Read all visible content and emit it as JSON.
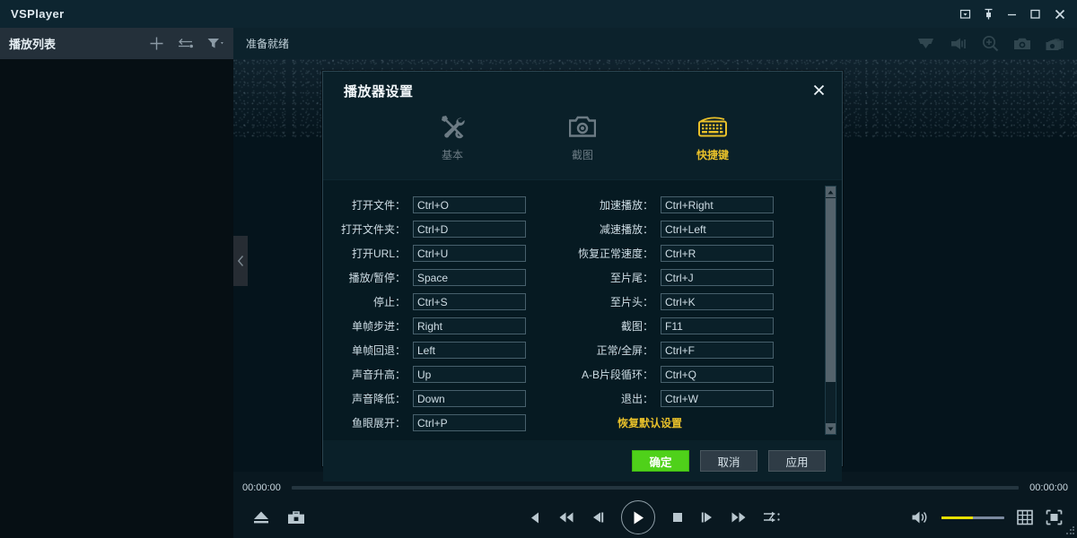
{
  "titlebar": {
    "app_title": "VSPlayer",
    "buttons": [
      {
        "name": "restore-down",
        "icon": "window-restore-icon"
      },
      {
        "name": "pin",
        "icon": "pin-icon"
      },
      {
        "name": "minimize",
        "icon": "minimize-icon"
      },
      {
        "name": "maximize",
        "icon": "maximize-icon"
      },
      {
        "name": "close",
        "icon": "close-icon"
      }
    ]
  },
  "playlist": {
    "title": "播放列表",
    "icons": [
      {
        "name": "add-icon",
        "label": "+"
      },
      {
        "name": "swap-icon",
        "label": "swap"
      },
      {
        "name": "filter-icon",
        "label": "filter"
      }
    ]
  },
  "video": {
    "status": "准备就绪",
    "toolbar_icons": [
      {
        "name": "ptz-dome-icon"
      },
      {
        "name": "audio-talk-icon"
      },
      {
        "name": "digital-zoom-icon"
      },
      {
        "name": "snapshot-icon"
      },
      {
        "name": "burst-snapshot-icon"
      }
    ],
    "collapse_handle": "‹"
  },
  "controls": {
    "time_current": "00:00:00",
    "time_total": "00:00:00",
    "progress_percent": 0,
    "volume_percent": 50,
    "buttons": [
      {
        "name": "eject-button"
      },
      {
        "name": "toolbox-button"
      },
      {
        "name": "step-back-button"
      },
      {
        "name": "rewind-button"
      },
      {
        "name": "frame-back-button"
      },
      {
        "name": "play-button"
      },
      {
        "name": "stop-button"
      },
      {
        "name": "frame-forward-button"
      },
      {
        "name": "fast-forward-button"
      },
      {
        "name": "playback-rate-button"
      },
      {
        "name": "volume-button"
      },
      {
        "name": "layout-grid-button"
      },
      {
        "name": "fullscreen-button"
      }
    ]
  },
  "dialog": {
    "title": "播放器设置",
    "close_label": "✕",
    "tabs": [
      {
        "label": "基本",
        "icon": "tools-icon",
        "active": false
      },
      {
        "label": "截图",
        "icon": "camera-icon",
        "active": false
      },
      {
        "label": "快捷键",
        "icon": "keyboard-icon",
        "active": true
      }
    ],
    "left_column": [
      {
        "label": "打开文件：",
        "value": "Ctrl+O"
      },
      {
        "label": "打开文件夹：",
        "value": "Ctrl+D"
      },
      {
        "label": "打开URL：",
        "value": "Ctrl+U"
      },
      {
        "label": "播放/暂停：",
        "value": "Space"
      },
      {
        "label": "停止：",
        "value": "Ctrl+S"
      },
      {
        "label": "单帧步进：",
        "value": "Right"
      },
      {
        "label": "单帧回退：",
        "value": "Left"
      },
      {
        "label": "声音升高：",
        "value": "Up"
      },
      {
        "label": "声音降低：",
        "value": "Down"
      },
      {
        "label": "鱼眼展开：",
        "value": "Ctrl+P"
      }
    ],
    "right_column": [
      {
        "label": "加速播放：",
        "value": "Ctrl+Right"
      },
      {
        "label": "减速播放：",
        "value": "Ctrl+Left"
      },
      {
        "label": "恢复正常速度：",
        "value": "Ctrl+R"
      },
      {
        "label": "至片尾：",
        "value": "Ctrl+J"
      },
      {
        "label": "至片头：",
        "value": "Ctrl+K"
      },
      {
        "label": "截图：",
        "value": "F11"
      },
      {
        "label": "正常/全屏：",
        "value": "Ctrl+F"
      },
      {
        "label": "A-B片段循环：",
        "value": "Ctrl+Q"
      },
      {
        "label": "退出：",
        "value": "Ctrl+W"
      }
    ],
    "restore_defaults": "恢复默认设置",
    "footer": {
      "ok": "确定",
      "cancel": "取消",
      "apply": "应用"
    }
  },
  "colors": {
    "accent_yellow": "#e8c02a",
    "ok_green": "#4fd11a",
    "titlebar_bg": "#0d2530",
    "dialog_bg": "#0a2029",
    "panel_bg": "#061a22"
  }
}
